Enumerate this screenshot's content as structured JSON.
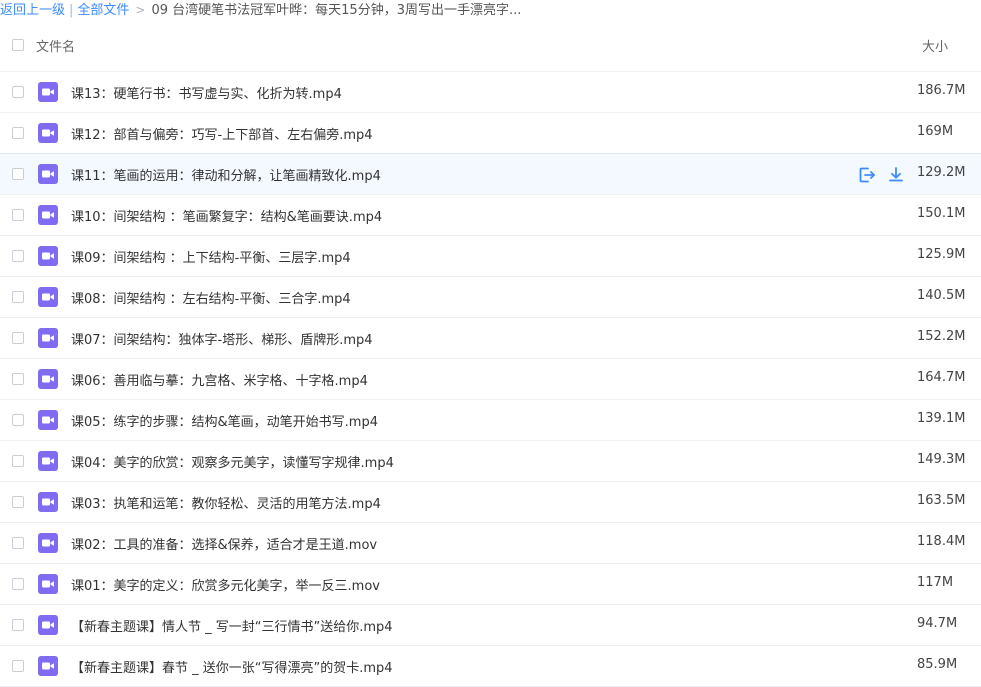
{
  "breadcrumb": {
    "back": "返回上一级",
    "separator": "|",
    "all_files": "全部文件",
    "chevron": ">",
    "current": "09 台湾硬笔书法冠军叶晔：每天15分钟，3周写出一手漂亮字..."
  },
  "header": {
    "name_label": "文件名",
    "size_label": "大小"
  },
  "colors": {
    "accent": "#3b8cff",
    "video_icon": "#7f6cf2",
    "hover_row": "#f4f8ff"
  },
  "files": [
    {
      "name": "课13：硬笔行书：书写虚与实、化折为转.mp4",
      "size": "186.7M",
      "icon": "video-file-icon"
    },
    {
      "name": "课12：部首与偏旁：巧写-上下部首、左右偏旁.mp4",
      "size": "169M",
      "icon": "video-file-icon"
    },
    {
      "name": "课11：笔画的运用：律动和分解，让笔画精致化.mp4",
      "size": "129.2M",
      "icon": "video-file-icon",
      "hover": true
    },
    {
      "name": "课10：间架结构 ：笔画繁复字：结构&笔画要诀.mp4",
      "size": "150.1M",
      "icon": "video-file-icon"
    },
    {
      "name": "课09：间架结构 ：上下结构-平衡、三层字.mp4",
      "size": "125.9M",
      "icon": "video-file-icon"
    },
    {
      "name": "课08：间架结构 ：左右结构-平衡、三合字.mp4",
      "size": "140.5M",
      "icon": "video-file-icon"
    },
    {
      "name": "课07：间架结构：独体字-塔形、梯形、盾牌形.mp4",
      "size": "152.2M",
      "icon": "video-file-icon"
    },
    {
      "name": "课06：善用临与摹：九宫格、米字格、十字格.mp4",
      "size": "164.7M",
      "icon": "video-file-icon"
    },
    {
      "name": "课05：练字的步骤：结构&笔画，动笔开始书写.mp4",
      "size": "139.1M",
      "icon": "video-file-icon"
    },
    {
      "name": "课04：美字的欣赏：观察多元美字，读懂写字规律.mp4",
      "size": "149.3M",
      "icon": "video-file-icon"
    },
    {
      "name": "课03：执笔和运笔：教你轻松、灵活的用笔方法.mp4",
      "size": "163.5M",
      "icon": "video-file-icon"
    },
    {
      "name": "课02：工具的准备：选择&保养，适合才是王道.mov",
      "size": "118.4M",
      "icon": "video-file-icon"
    },
    {
      "name": "课01：美字的定义：欣赏多元化美字，举一反三.mov",
      "size": "117M",
      "icon": "video-file-icon"
    },
    {
      "name": "【新春主题课】情人节 _ 写一封“三行情书”送给你.mp4",
      "size": "94.7M",
      "icon": "video-file-icon"
    },
    {
      "name": "【新春主题课】春节 _ 送你一张“写得漂亮”的贺卡.mp4",
      "size": "85.9M",
      "icon": "video-file-icon"
    }
  ]
}
